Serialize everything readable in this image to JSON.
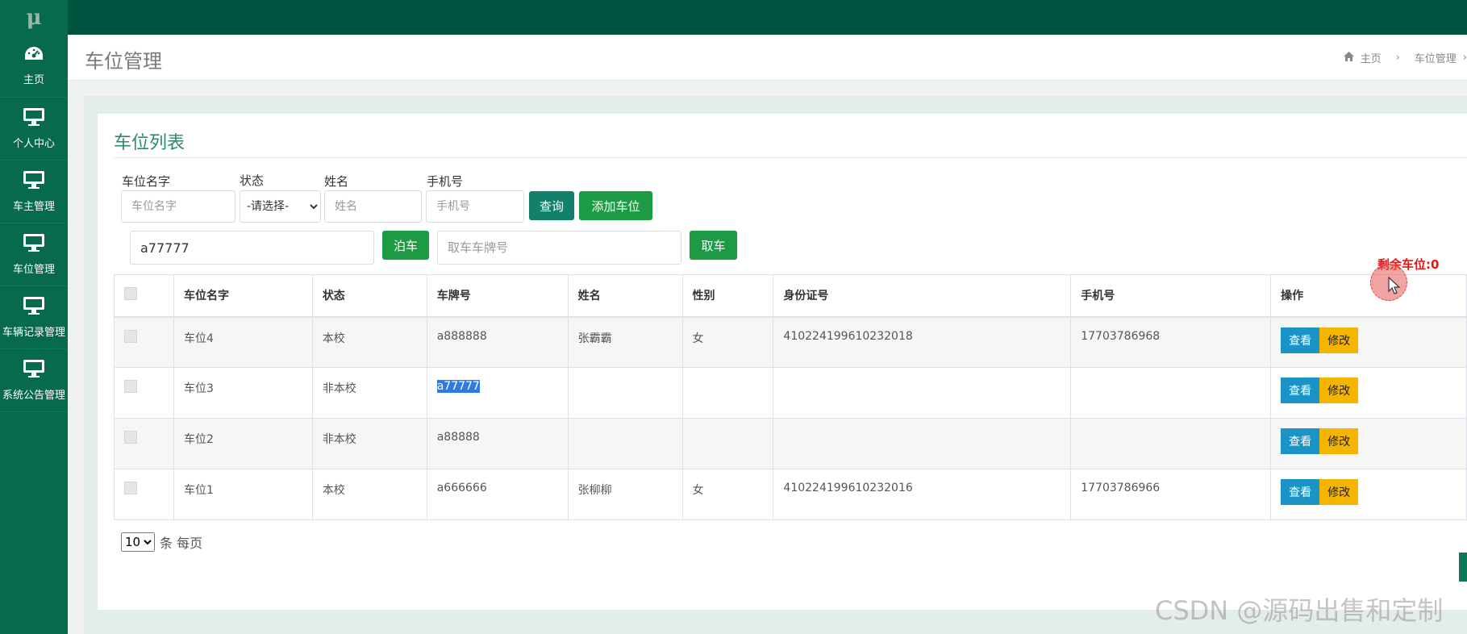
{
  "app": {
    "logo": "μ"
  },
  "sidebar": {
    "items": [
      {
        "label": "主页",
        "icon": "dashboard-icon"
      },
      {
        "label": "个人中心",
        "icon": "monitor-icon"
      },
      {
        "label": "车主管理",
        "icon": "monitor-icon"
      },
      {
        "label": "车位管理",
        "icon": "monitor-icon"
      },
      {
        "label": "车辆记录管理",
        "icon": "monitor-icon"
      },
      {
        "label": "系统公告管理",
        "icon": "monitor-icon"
      }
    ]
  },
  "header": {
    "title": "车位管理",
    "breadcrumb": {
      "home": "主页",
      "current": "车位管理"
    }
  },
  "card": {
    "title": "车位列表"
  },
  "filters": {
    "name_label": "车位名字",
    "name_placeholder": "车位名字",
    "status_label": "状态",
    "status_value": "-请选择-",
    "person_label": "姓名",
    "person_placeholder": "姓名",
    "phone_label": "手机号",
    "phone_placeholder": "手机号",
    "search_button": "查询",
    "add_button": "添加车位"
  },
  "parking": {
    "park_value": "a77777",
    "park_button": "泊车",
    "pickup_placeholder": "取车车牌号",
    "pickup_button": "取车"
  },
  "remaining": "剩余车位:0",
  "table": {
    "headers": [
      "车位名字",
      "状态",
      "车牌号",
      "姓名",
      "性别",
      "身份证号",
      "手机号",
      "操作"
    ],
    "rows": [
      {
        "name": "车位4",
        "status": "本校",
        "plate": "a888888",
        "person": "张霸霸",
        "gender": "女",
        "id_card": "410224199610232018",
        "phone": "17703786968"
      },
      {
        "name": "车位3",
        "status": "非本校",
        "plate": "a77777",
        "person": "",
        "gender": "",
        "id_card": "",
        "phone": ""
      },
      {
        "name": "车位2",
        "status": "非本校",
        "plate": "a88888",
        "person": "",
        "gender": "",
        "id_card": "",
        "phone": ""
      },
      {
        "name": "车位1",
        "status": "本校",
        "plate": "a666666",
        "person": "张柳柳",
        "gender": "女",
        "id_card": "410224199610232016",
        "phone": "17703786966"
      }
    ],
    "view_label": "查看",
    "edit_label": "修改"
  },
  "pagination": {
    "page_size": "10",
    "suffix": "条 每页"
  },
  "watermark": "CSDN @源码出售和定制",
  "colors": {
    "sidebar": "#086a4d",
    "topbar": "#00533f",
    "accent": "#2e8b67",
    "danger": "#e11111"
  }
}
